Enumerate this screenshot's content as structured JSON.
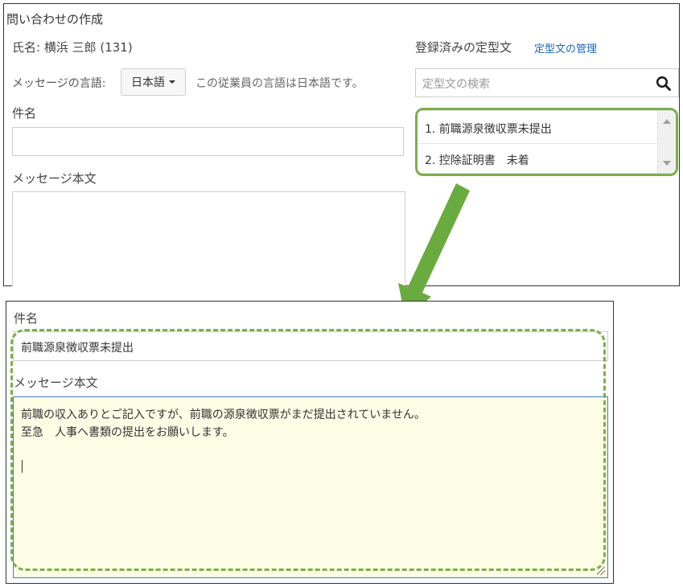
{
  "top_panel": {
    "title": "問い合わせの作成",
    "employee_name": "氏名: 横浜 三郎 (131)",
    "language_label": "メッセージの言語:",
    "language_value": "日本語",
    "language_note": "この従業員の言語は日本語です。",
    "subject_label": "件名",
    "subject_value": "",
    "message_label": "メッセージ本文",
    "message_value": "",
    "templates": {
      "heading": "登録済みの定型文",
      "manage_link": "定型文の管理",
      "search_placeholder": "定型文の検索",
      "items": [
        {
          "label": "1. 前職源泉徴収票未提出"
        },
        {
          "label": "2. 控除証明書　未着"
        }
      ]
    }
  },
  "bottom_panel": {
    "subject_label": "件名",
    "subject_value": "前職源泉徴収票未提出",
    "message_label": "メッセージ本文",
    "message_lines": [
      "前職の収入ありとご記入ですが、前職の源泉徴収票がまだ提出されていません。",
      "至急　人事へ書類の提出をお願いします。"
    ]
  },
  "colors": {
    "highlight_green": "#7ab04a",
    "arrow_green": "#6aab3f",
    "link_blue": "#1a66c2",
    "message_bg": "#fdfde6",
    "focus_border": "#4a78c2"
  },
  "icons": [
    "search-icon",
    "caret-down-icon",
    "arrow-down-icon",
    "resize-grip-icon"
  ]
}
